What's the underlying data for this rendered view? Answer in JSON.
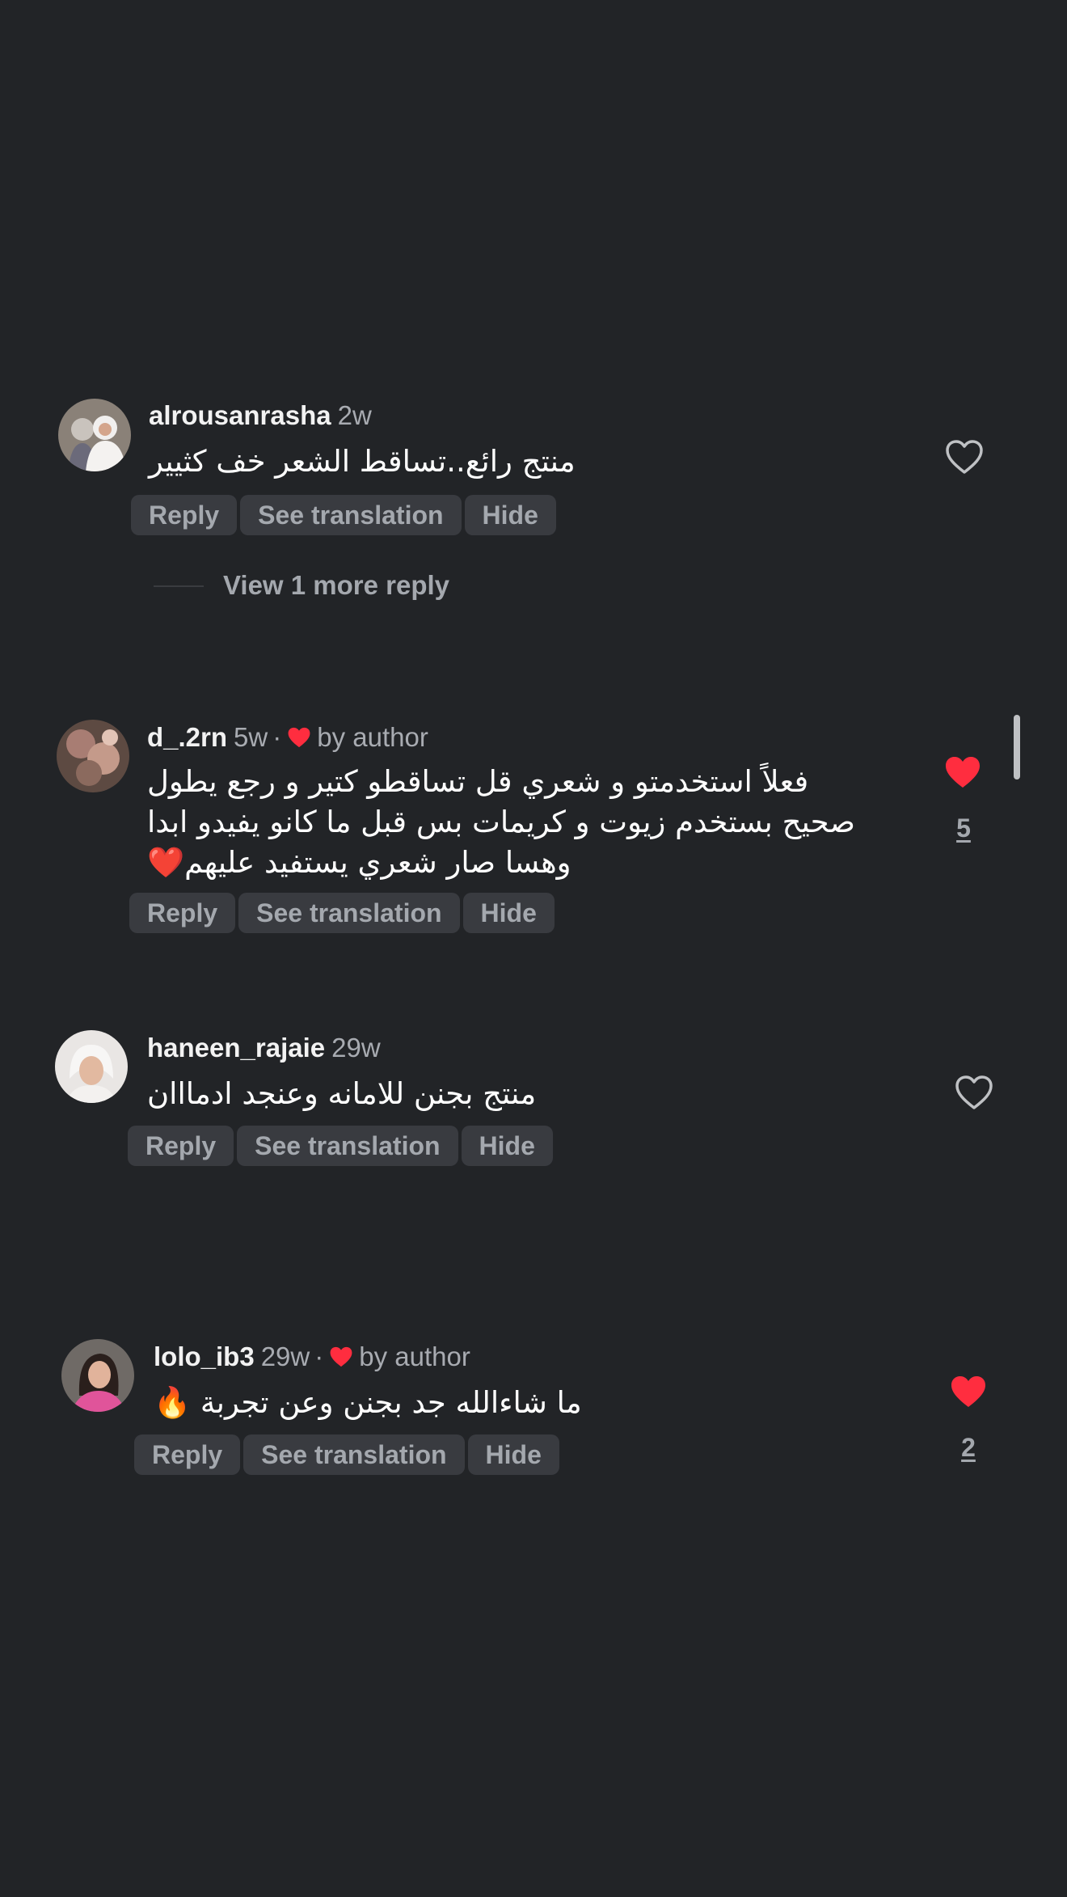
{
  "comments": [
    {
      "username": "alrousanrasha",
      "time": "2w",
      "text_lines": [
        "منتج رائع..تساقط الشعر خف كثيير"
      ],
      "liked": false,
      "like_count": "",
      "actions": [
        "Reply",
        "See translation",
        "Hide"
      ],
      "view_more": "View 1 more reply"
    },
    {
      "username": "d_.2rn",
      "time": "5w",
      "by_author": "by author",
      "text_lines": [
        "فعلاً استخدمتو و شعري قل تساقطو كتير و رجع يطول",
        "صحيح بستخدم زيوت و كريمات بس قبل ما كانو يفيدو ابدا",
        "وهسا صار شعري يستفيد عليهم❤️"
      ],
      "liked": true,
      "like_count": "5",
      "actions": [
        "Reply",
        "See translation",
        "Hide"
      ]
    },
    {
      "username": "haneen_rajaie",
      "time": "29w",
      "text_lines": [
        "منتج بجنن للامانه وعنجد ادمااان"
      ],
      "liked": false,
      "like_count": "",
      "actions": [
        "Reply",
        "See translation",
        "Hide"
      ]
    },
    {
      "username": "lolo_ib3",
      "time": "29w",
      "by_author": "by author",
      "text_lines": [
        "ما شاءالله جد بجنن وعن تجربة 🔥"
      ],
      "liked": true,
      "like_count": "2",
      "actions": [
        "Reply",
        "See translation",
        "Hide"
      ]
    }
  ],
  "colors": {
    "background": "#222427",
    "pill": "#393b40",
    "muted_text": "#a4a8ae",
    "heart_red": "#ff2d3f"
  },
  "icons": {
    "like_empty": "heart-outline-icon",
    "like_filled": "heart-filled-icon"
  }
}
